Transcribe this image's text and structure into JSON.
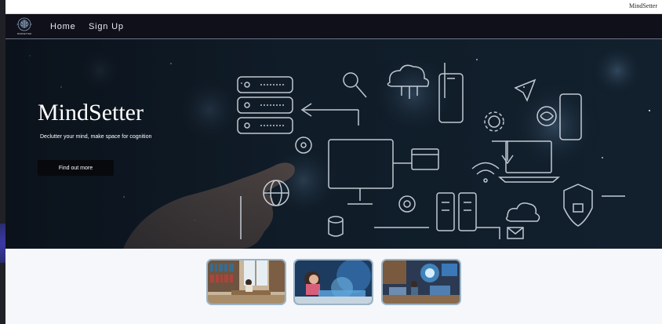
{
  "window": {
    "title": "MindSetter"
  },
  "nav": {
    "logo_icon": "brain-logo-icon",
    "logo_text": "MINDSETTER",
    "links": [
      {
        "label": "Home"
      },
      {
        "label": "Sign Up"
      }
    ]
  },
  "hero": {
    "title": "MindSetter",
    "subtitle": "Declutter your mind, make space for cognition",
    "button_label": "Find out more",
    "background_icons": [
      "server-icon",
      "magnifier-icon",
      "cloud-network-icon",
      "smartphone-icon",
      "paper-plane-icon",
      "gear-icon",
      "brain-icon",
      "monitor-icon",
      "browser-www-icon",
      "wifi-icon",
      "laptop-icon",
      "globe-icon",
      "at-sign-icon",
      "database-icon",
      "shield-lock-icon",
      "cursor-hand-icon"
    ]
  },
  "gallery": {
    "images": [
      {
        "name": "library-study-photo"
      },
      {
        "name": "child-tech-photo"
      },
      {
        "name": "classroom-tech-photo"
      }
    ]
  },
  "colors": {
    "navbar_bg": "#0f1019",
    "hero_overlay": "#0b1621",
    "button_bg": "#08090c",
    "page_bg": "#f5f7fa",
    "thumb_border": "#9bb3c7"
  }
}
